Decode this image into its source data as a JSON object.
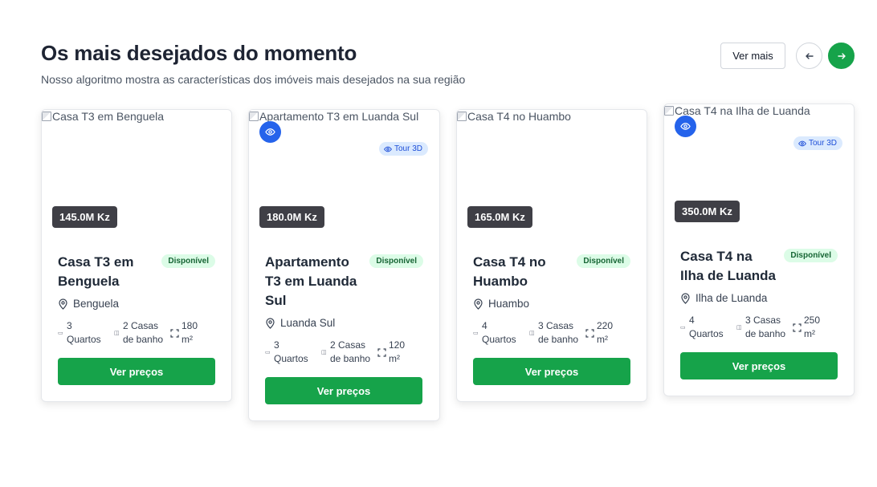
{
  "section": {
    "title": "Os mais desejados do momento",
    "subtitle": "Nosso algoritmo mostra as características dos imóveis mais desejados na sua região"
  },
  "controls": {
    "ver_mais_label": "Ver mais",
    "prev_icon": "arrow-left-icon",
    "next_icon": "arrow-right-icon"
  },
  "colors": {
    "primary": "#16a34a",
    "price_badge": "#3f3f46",
    "tour_badge_bg": "#dbeafe",
    "eye_badge": "#2563eb",
    "status_bg": "#dcfce7"
  },
  "cards": [
    {
      "image_alt": "Casa T3 em Benguela",
      "price": "145.0M Kz",
      "title": "Casa T3 em Benguela",
      "status": "Disponível",
      "location": "Benguela",
      "rooms": "3 Quartos",
      "baths": "2 Casas de banho",
      "area": "180 m²",
      "cta": "Ver preços",
      "has_tour": false
    },
    {
      "image_alt": "Apartamento T3 em Luanda Sul",
      "price": "180.0M Kz",
      "title": "Apartamento T3 em Luanda Sul",
      "status": "Disponível",
      "location": "Luanda Sul",
      "rooms": "3 Quartos",
      "baths": "2 Casas de banho",
      "area": "120 m²",
      "cta": "Ver preços",
      "has_tour": true,
      "tour_label": "Tour 3D"
    },
    {
      "image_alt": "Casa T4 no Huambo",
      "price": "165.0M Kz",
      "title": "Casa T4 no Huambo",
      "status": "Disponível",
      "location": "Huambo",
      "rooms": "4 Quartos",
      "baths": "3 Casas de banho",
      "area": "220 m²",
      "cta": "Ver preços",
      "has_tour": false
    },
    {
      "image_alt": "Casa T4 na Ilha de Luanda",
      "price": "350.0M Kz",
      "title": "Casa T4 na Ilha de Luanda",
      "status": "Disponível",
      "location": "Ilha de Luanda",
      "rooms": "4 Quartos",
      "baths": "3 Casas de banho",
      "area": "250 m²",
      "cta": "Ver preços",
      "has_tour": true,
      "tour_label": "Tour 3D"
    }
  ]
}
